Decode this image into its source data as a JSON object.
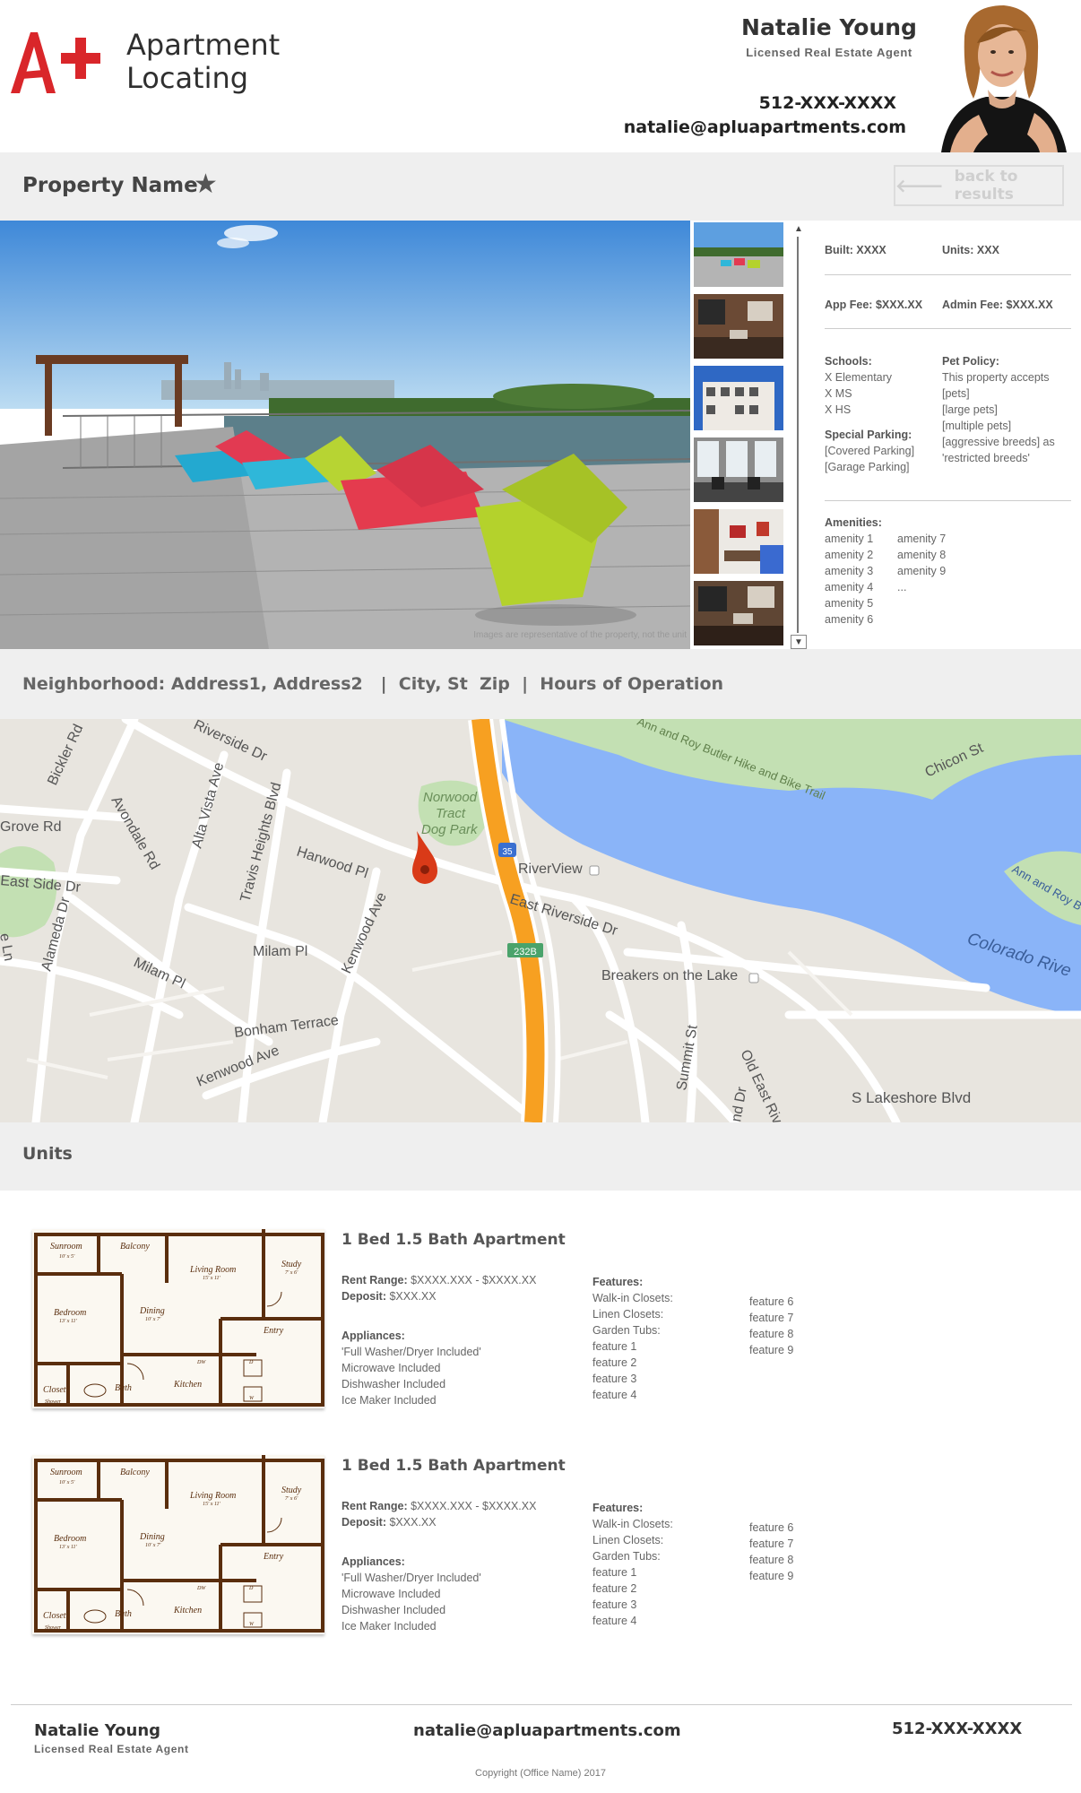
{
  "header": {
    "logo_mark": "A+",
    "logo_line1": "Apartment",
    "logo_line2": "Locating",
    "agent_name": "Natalie Young",
    "agent_title": "Licensed Real Estate Agent",
    "agent_phone": "512-XXX-XXXX",
    "agent_email": "natalie@apluapartments.com"
  },
  "property": {
    "name": "Property Name",
    "favorite_icon": "star-icon",
    "back_label": "back to results",
    "back_icon": "arrow-left-icon"
  },
  "gallery": {
    "caption": "Images are representative of the property,  not the unit",
    "thumbnail_count": 6
  },
  "details": {
    "built_label": "Built:",
    "built_value": "XXXX",
    "units_label": "Units:",
    "units_value": "XXX",
    "app_fee_label": "App Fee:",
    "app_fee_value": "$XXX.XX",
    "admin_fee_label": "Admin Fee:",
    "admin_fee_value": "$XXX.XX",
    "schools_label": "Schools:",
    "schools": [
      "X Elementary",
      "X MS",
      "X HS"
    ],
    "special_parking_label": "Special Parking:",
    "parking": [
      "[Covered Parking]",
      "[Garage Parking]"
    ],
    "pet_policy_label": "Pet Policy:",
    "pet_policy": [
      "This property accepts",
      "[pets]",
      "[large pets]",
      "[multiple pets]",
      "[aggressive breeds] as",
      "'restricted breeds'"
    ],
    "amenities_label": "Amenities:",
    "amenities_col1": [
      "amenity 1",
      "amenity 2",
      "amenity 3",
      "amenity 4",
      "amenity 5",
      "amenity 6"
    ],
    "amenities_col2": [
      "amenity 7",
      "amenity 8",
      "amenity 9",
      "..."
    ]
  },
  "neighborhood": {
    "text": "Neighborhood: Address1, Address2   |  City, St  Zip  |  Hours of Operation"
  },
  "map": {
    "labels": {
      "bickler": "Bickler Rd",
      "riverside_dr": "Riverside Dr",
      "grove": "Grove Rd",
      "east_side": "East Side Dr",
      "avondale": "Avondale Rd",
      "alta_vista": "Alta Vista Ave",
      "travis_heights": "Travis Heights Blvd",
      "harwood": "Harwood Pl",
      "alameda": "Alameda Dr",
      "eln": "e Ln",
      "milam_pl1": "Milam Pl",
      "milam_pl2": "Milam Pl",
      "kenwood1": "Kenwood Ave",
      "kenwood2": "Kenwood Ave",
      "bonham": "Bonham Terrace",
      "norwood1": "Norwood",
      "norwood2": "Tract",
      "norwood3": "Dog Park",
      "riverview": "RiverView",
      "east_riverside": "East Riverside Dr",
      "breakers": "Breakers on the Lake",
      "trail": "Ann and Roy Butler Hike and Bike Trail",
      "chicon": "Chicon St",
      "colorado": "Colorado Rive",
      "ann_roy": "Ann and Roy B",
      "summit": "Summit St",
      "old_east": "Old East River",
      "nd_dr": "nd Dr",
      "lakeshore": "S Lakeshore Blvd",
      "i35": "35",
      "exit": "232B"
    }
  },
  "units": {
    "title": "Units",
    "list": [
      {
        "title": "1 Bed  1.5 Bath  Apartment",
        "rent_label": "Rent Range:",
        "rent_value": "$XXXX.XXX - $XXXX.XX",
        "deposit_label": "Deposit:",
        "deposit_value": "$XXX.XX",
        "appliances_label": "Appliances:",
        "appliances": [
          "'Full Washer/Dryer Included'",
          "Microwave Included",
          "Dishwasher Included",
          "Ice Maker Included"
        ],
        "features_label": "Features:",
        "features_col1": [
          "Walk-in Closets:",
          "Linen Closets:",
          "Garden Tubs:",
          "feature 1",
          "feature 2",
          "feature 3",
          "feature 4"
        ],
        "features_col2": [
          "feature 6",
          "feature 7",
          "feature 8",
          "feature 9"
        ]
      },
      {
        "title": "1 Bed  1.5 Bath  Apartment",
        "rent_label": "Rent Range:",
        "rent_value": "$XXXX.XXX - $XXXX.XX",
        "deposit_label": "Deposit:",
        "deposit_value": "$XXX.XX",
        "appliances_label": "Appliances:",
        "appliances": [
          "'Full Washer/Dryer Included'",
          "Microwave Included",
          "Dishwasher Included",
          "Ice Maker Included"
        ],
        "features_label": "Features:",
        "features_col1": [
          "Walk-in Closets:",
          "Linen Closets:",
          "Garden Tubs:",
          "feature 1",
          "feature 2",
          "feature 3",
          "feature 4"
        ],
        "features_col2": [
          "feature 6",
          "feature 7",
          "feature 8",
          "feature 9"
        ]
      }
    ],
    "floorplan_rooms": {
      "sunroom": "Sunroom",
      "sunroom_dim": "10' x 5'",
      "balcony": "Balcony",
      "living": "Living Room",
      "living_dim": "15' x 11'",
      "study": "Study",
      "study_dim": "7' x 6'",
      "bedroom": "Bedroom",
      "bedroom_dim": "13' x 11'",
      "dining": "Dining",
      "dining_dim": "10' x 7'",
      "entry": "Entry",
      "closet": "Closet",
      "bath": "Bath",
      "kitchen": "Kitchen",
      "shower": "Shower",
      "dw": "DW",
      "d": "D",
      "w": "W"
    }
  },
  "footer": {
    "name": "Natalie Young",
    "title": "Licensed Real Estate Agent",
    "email": "natalie@apluapartments.com",
    "phone": "512-XXX-XXXX",
    "copyright": "Copyright (Office Name) 2017"
  },
  "colors": {
    "logo_red": "#d9262a",
    "bar_gray": "#efefef",
    "water_blue": "#8ab4f8",
    "park_green": "#c3e0b3",
    "highway_orange": "#f7a021",
    "pin_red": "#d93a18",
    "floorplan_brown": "#5a2e0e"
  }
}
